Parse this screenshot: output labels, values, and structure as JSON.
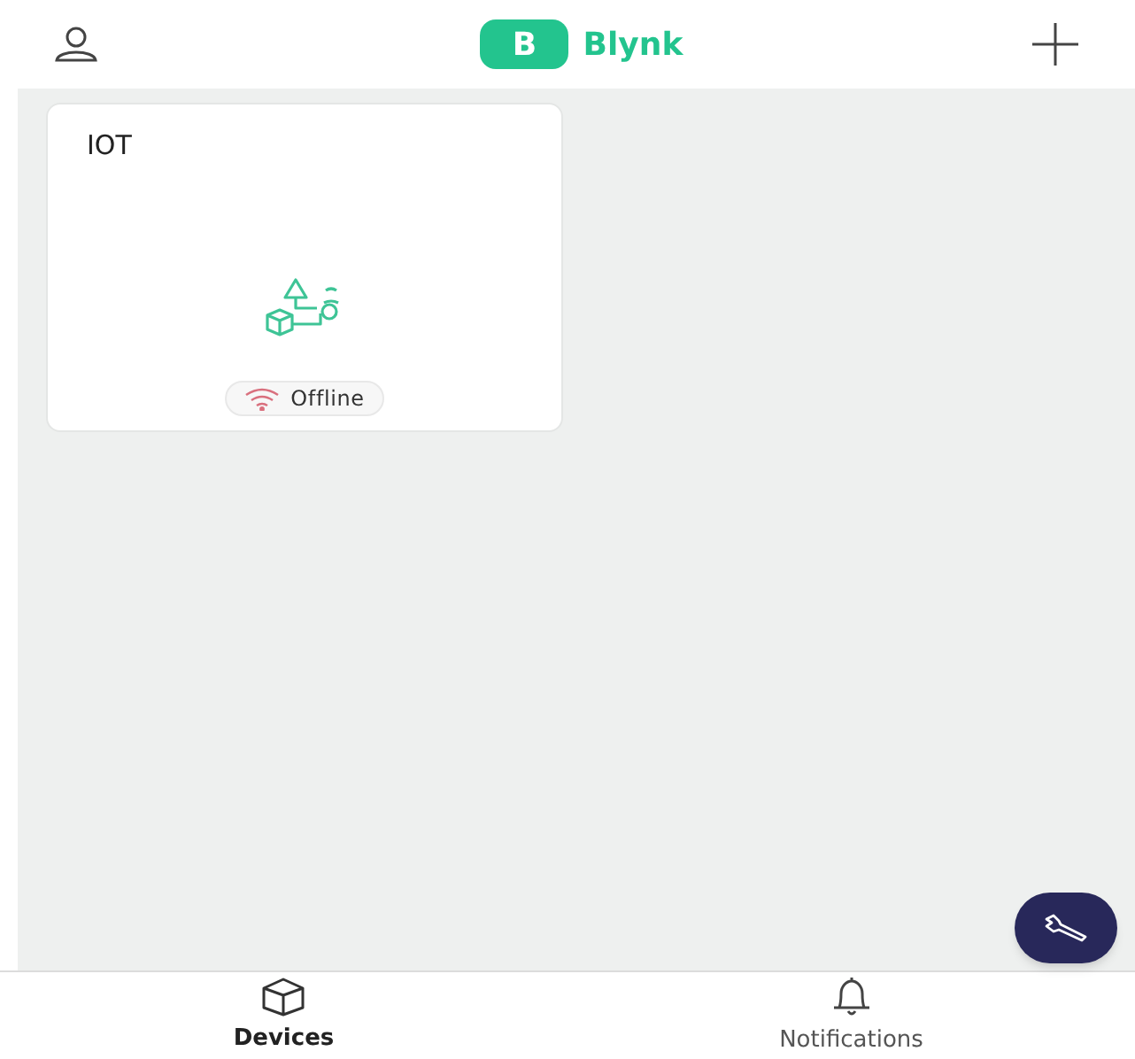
{
  "header": {
    "logo_letter": "B",
    "title": "Blynk"
  },
  "devices": [
    {
      "name": "IOT",
      "status": "Offline",
      "online": false
    }
  ],
  "tabs": [
    {
      "label": "Devices",
      "selected": true,
      "kind": "devices"
    },
    {
      "label": "Notifications",
      "selected": false,
      "kind": "notifications"
    }
  ]
}
